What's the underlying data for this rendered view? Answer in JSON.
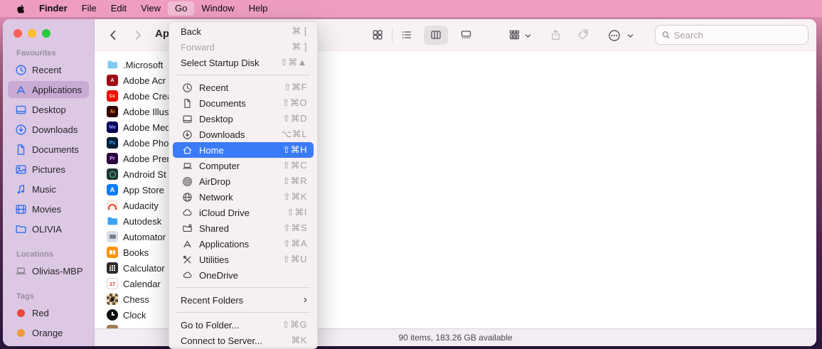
{
  "colors": {
    "accent_blue": "#3b7bf7",
    "menubar_pink": "#ee9dc1",
    "sidebar_pink": "#dcc8e2",
    "selected_sidebar_row": "#c8aad2",
    "tag_red": "#f04438",
    "tag_orange": "#f09a37"
  },
  "menubar": {
    "apple_icon": "apple-logo",
    "items": [
      "Finder",
      "File",
      "Edit",
      "View",
      "Go",
      "Window",
      "Help"
    ],
    "active_item": "Go"
  },
  "toolbar": {
    "title": "Ap",
    "search_placeholder": "Search"
  },
  "sidebar": {
    "sections": [
      {
        "title": "Favourites",
        "items": [
          {
            "label": "Recent"
          },
          {
            "label": "Applications",
            "selected": true
          },
          {
            "label": "Desktop"
          },
          {
            "label": "Downloads"
          },
          {
            "label": "Documents"
          },
          {
            "label": "Pictures"
          },
          {
            "label": "Music"
          },
          {
            "label": "Movies"
          },
          {
            "label": "OLIVIA"
          }
        ]
      },
      {
        "title": "Locations",
        "items": [
          {
            "label": "Olivias-MBP"
          }
        ]
      },
      {
        "title": "Tags",
        "items": [
          {
            "label": "Red"
          },
          {
            "label": "Orange"
          }
        ]
      }
    ]
  },
  "files": [
    {
      "name": ".Microsoft",
      "badge": ""
    },
    {
      "name": "Adobe Acr",
      "badge": "A"
    },
    {
      "name": "Adobe Crea",
      "badge": "Cc"
    },
    {
      "name": "Adobe Illus",
      "badge": "Ai"
    },
    {
      "name": "Adobe Med",
      "badge": "Me"
    },
    {
      "name": "Adobe Pho",
      "badge": "Ps"
    },
    {
      "name": "Adobe Prer",
      "badge": "Pr"
    },
    {
      "name": "Android St",
      "badge": ""
    },
    {
      "name": "App Store",
      "badge": "A"
    },
    {
      "name": "Audacity",
      "badge": ""
    },
    {
      "name": "Autodesk",
      "badge": ""
    },
    {
      "name": "Automator",
      "badge": ""
    },
    {
      "name": "Books",
      "badge": ""
    },
    {
      "name": "Calculator",
      "badge": ""
    },
    {
      "name": "Calendar",
      "badge": "17"
    },
    {
      "name": "Chess",
      "badge": "♞"
    },
    {
      "name": "Clock",
      "badge": ""
    }
  ],
  "go_menu": {
    "highlighted_item": "Home",
    "disabled_item": "Forward",
    "items": [
      {
        "label": "Back",
        "shortcut": "⌘ ["
      },
      {
        "label": "Forward",
        "shortcut": "⌘ ]"
      },
      {
        "label": "Select Startup Disk",
        "shortcut": "⇧⌘▲"
      },
      {
        "label": "Recent",
        "shortcut": "⇧⌘F"
      },
      {
        "label": "Documents",
        "shortcut": "⇧⌘O"
      },
      {
        "label": "Desktop",
        "shortcut": "⇧⌘D"
      },
      {
        "label": "Downloads",
        "shortcut": "⌥⌘L"
      },
      {
        "label": "Home",
        "shortcut": "⇧⌘H"
      },
      {
        "label": "Computer",
        "shortcut": "⇧⌘C"
      },
      {
        "label": "AirDrop",
        "shortcut": "⇧⌘R"
      },
      {
        "label": "Network",
        "shortcut": "⇧⌘K"
      },
      {
        "label": "iCloud Drive",
        "shortcut": "⇧⌘I"
      },
      {
        "label": "Shared",
        "shortcut": "⇧⌘S"
      },
      {
        "label": "Applications",
        "shortcut": "⇧⌘A"
      },
      {
        "label": "Utilities",
        "shortcut": "⇧⌘U"
      },
      {
        "label": "OneDrive",
        "shortcut": ""
      },
      {
        "label": "Recent Folders",
        "submenu_arrow": "›"
      },
      {
        "label": "Go to Folder...",
        "shortcut": "⇧⌘G"
      },
      {
        "label": "Connect to Server...",
        "shortcut": "⌘K"
      }
    ]
  },
  "statusbar": {
    "text": "90 items, 183.26 GB available"
  }
}
